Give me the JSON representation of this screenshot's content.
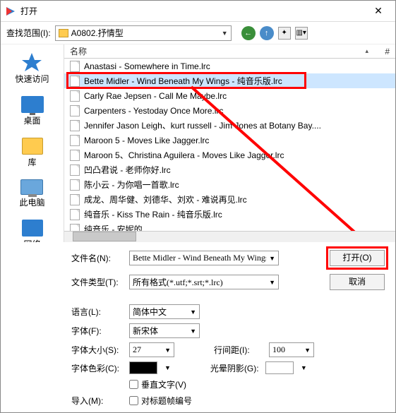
{
  "title": "打开",
  "toolbar": {
    "lookin_label": "查找范围(I):",
    "folder": "A0802.抒情型"
  },
  "sidebar": [
    {
      "key": "quick",
      "label": "快速访问"
    },
    {
      "key": "desktop",
      "label": "桌面"
    },
    {
      "key": "lib",
      "label": "库"
    },
    {
      "key": "pc",
      "label": "此电脑"
    },
    {
      "key": "net",
      "label": "网络"
    }
  ],
  "list": {
    "header_name": "名称",
    "header_hash": "#",
    "items": [
      {
        "name": "Anastasi - Somewhere in Time.lrc",
        "sel": false
      },
      {
        "name": "Bette Midler - Wind Beneath My Wings - 纯音乐版.lrc",
        "sel": true
      },
      {
        "name": "Carly Rae Jepsen - Call Me Maybe.lrc",
        "sel": false
      },
      {
        "name": "Carpenters - Yestoday Once More.lrc",
        "sel": false
      },
      {
        "name": "Jennifer Jason Leigh、kurt russell - Jim Jones at Botany Bay....",
        "sel": false
      },
      {
        "name": "Maroon 5 - Moves Like Jagger.lrc",
        "sel": false
      },
      {
        "name": "Maroon 5、Christina Aguilera - Moves Like Jagger.lrc",
        "sel": false
      },
      {
        "name": "凹凸君说 - 老师你好.lrc",
        "sel": false
      },
      {
        "name": "陈小云 - 为你唱一首歌.lrc",
        "sel": false
      },
      {
        "name": "成龙、周华健、刘德华、刘欢 - 难说再见.lrc",
        "sel": false
      },
      {
        "name": "纯音乐 - Kiss The Rain - 纯音乐版.lrc",
        "sel": false
      },
      {
        "name": "纯音乐 - 安妮的",
        "sel": false
      }
    ]
  },
  "file": {
    "name_label": "文件名(N):",
    "name_value": "Bette Midler - Wind Beneath My Wings",
    "type_label": "文件类型(T):",
    "type_value": "所有格式(*.utf;*.srt;*.lrc)"
  },
  "buttons": {
    "open": "打开(O)",
    "cancel": "取消"
  },
  "opts": {
    "lang_label": "语言(L):",
    "lang_value": "简体中文",
    "font_label": "字体(F):",
    "font_value": "新宋体",
    "size_label": "字体大小(S):",
    "size_value": "27",
    "lh_label": "行间距(I):",
    "lh_value": "100",
    "color_label": "字体色彩(C):",
    "shadow_label": "光晕阴影(G):",
    "vert_label": "垂直文字(V)",
    "import_label": "导入(M):",
    "import_chk": "对标题帧编号"
  }
}
